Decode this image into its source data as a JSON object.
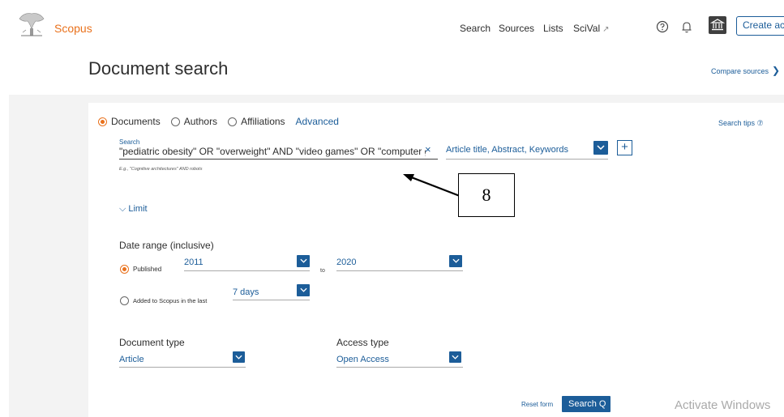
{
  "header": {
    "brand": "Scopus",
    "nav": {
      "search": "Search",
      "sources": "Sources",
      "lists": "Lists",
      "scival": "SciVal",
      "scival_ext": "↗"
    },
    "create_account": "Create acc"
  },
  "page": {
    "title": "Document search",
    "compare_sources": "Compare sources",
    "compare_chevron": "❯"
  },
  "search_form": {
    "tabs": {
      "documents": "Documents",
      "authors": "Authors",
      "affiliations": "Affiliations",
      "advanced": "Advanced"
    },
    "search_tips": "Search tips ⑦",
    "search_label": "Search",
    "search_value": "\"pediatric obesity\" OR \"overweight\" AND  \"video games\" OR \"computer ga",
    "clear": "×",
    "example": "E.g., \"Cognitive architectures\" AND robots",
    "field_select": "Article title, Abstract, Keywords",
    "add_field": "+",
    "annotation": "8",
    "limit": "Limit",
    "limit_chevron": "⌵",
    "date_range_label": "Date range (inclusive)",
    "published_label": "Published",
    "from_year": "2011",
    "to_label": "to",
    "to_year": "2020",
    "added_label": "Added to Scopus in the last",
    "added_value": "7 days",
    "document_type_label": "Document type",
    "document_type_value": "Article",
    "access_type_label": "Access type",
    "access_type_value": "Open Access",
    "reset_form": "Reset form",
    "search_button": "Search Q"
  },
  "watermark": "Activate Windows",
  "colors": {
    "brand_orange": "#e9711c",
    "link_blue": "#1c5d99",
    "band_gray": "#f3f3f3"
  }
}
